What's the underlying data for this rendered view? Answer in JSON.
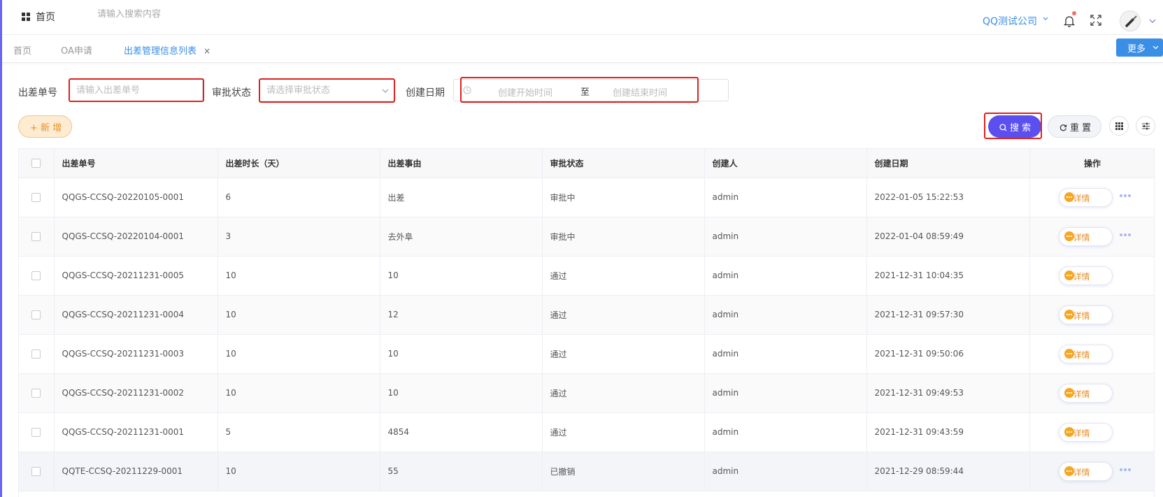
{
  "header": {
    "home_label": "首页",
    "search_placeholder": "请输入搜索内容",
    "company": "QQ测试公司"
  },
  "tabs": [
    {
      "label": "首页"
    },
    {
      "label": "OA申请"
    },
    {
      "label": "出差管理信息列表",
      "close": "×"
    }
  ],
  "more_label": "更多",
  "filters": {
    "order_no_label": "出差单号",
    "order_no_placeholder": "请输入出差单号",
    "status_label": "审批状态",
    "status_placeholder": "请选择审批状态",
    "date_label": "创建日期",
    "date_start_placeholder": "创建开始时间",
    "date_separator": "至",
    "date_end_placeholder": "创建结束时间"
  },
  "actions": {
    "add_label": "+ 新 增",
    "search_label": "搜 索",
    "reset_label": "重 置"
  },
  "table": {
    "columns": [
      "出差单号",
      "出差时长（天）",
      "出差事由",
      "审批状态",
      "创建人",
      "创建日期",
      "操作"
    ],
    "detail_label": "详情",
    "rows": [
      {
        "no": "QQGS-CCSQ-20220105-0001",
        "days": "6",
        "reason": "出差",
        "status": "审批中",
        "creator": "admin",
        "date": "2022-01-05 15:22:53"
      },
      {
        "no": "QQGS-CCSQ-20220104-0001",
        "days": "3",
        "reason": "去外阜",
        "status": "审批中",
        "creator": "admin",
        "date": "2022-01-04 08:59:49"
      },
      {
        "no": "QQGS-CCSQ-20211231-0005",
        "days": "10",
        "reason": "10",
        "status": "通过",
        "creator": "admin",
        "date": "2021-12-31 10:04:35"
      },
      {
        "no": "QQGS-CCSQ-20211231-0004",
        "days": "10",
        "reason": "12",
        "status": "通过",
        "creator": "admin",
        "date": "2021-12-31 09:57:30"
      },
      {
        "no": "QQGS-CCSQ-20211231-0003",
        "days": "10",
        "reason": "10",
        "status": "通过",
        "creator": "admin",
        "date": "2021-12-31 09:50:06"
      },
      {
        "no": "QQGS-CCSQ-20211231-0002",
        "days": "10",
        "reason": "10",
        "status": "通过",
        "creator": "admin",
        "date": "2021-12-31 09:49:53"
      },
      {
        "no": "QQGS-CCSQ-20211231-0001",
        "days": "5",
        "reason": "4854",
        "status": "通过",
        "creator": "admin",
        "date": "2021-12-31 09:43:59"
      },
      {
        "no": "QQTE-CCSQ-20211229-0001",
        "days": "10",
        "reason": "55",
        "status": "已撤销",
        "creator": "admin",
        "date": "2021-12-29 08:59:44"
      }
    ]
  },
  "colors": {
    "accent": "#3a8ee6",
    "primary_button": "#5b4ff0",
    "warning": "#e8912a",
    "annotation_box": "#e02020"
  }
}
